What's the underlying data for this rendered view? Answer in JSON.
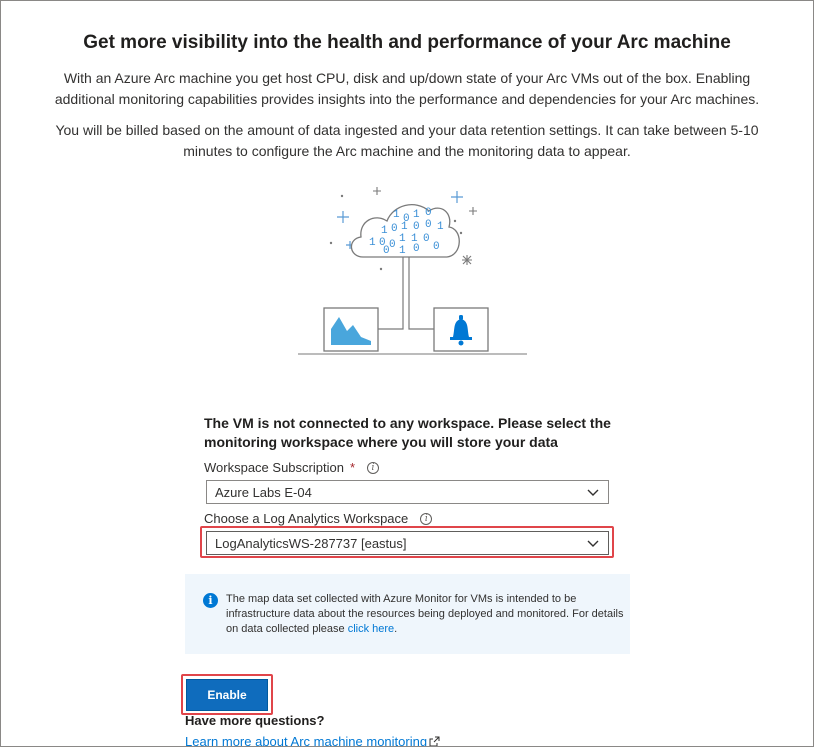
{
  "header": {
    "title": "Get more visibility into the health and performance of your Arc machine"
  },
  "intro": {
    "paragraph1": "With an Azure Arc machine you get host CPU, disk and up/down state of your Arc VMs out of the box.  Enabling additional monitoring capabilities provides insights into the performance and dependencies for your Arc machines.",
    "paragraph2": "You will be billed based on the amount of data ingested and your data retention settings. It can take between 5-10 minutes to configure the Arc machine and the monitoring data to appear."
  },
  "illustration": {
    "cloud_digits": [
      "1",
      "0",
      "1",
      "0",
      "0",
      "1",
      "1",
      "0",
      "1",
      "0",
      "0",
      "1",
      "1",
      "0",
      "0",
      "1",
      "0",
      "0",
      "1",
      "0"
    ],
    "icons": [
      "cloud-icon",
      "chart-icon",
      "bell-icon"
    ]
  },
  "form": {
    "title": "The VM is not connected to any workspace. Please select the monitoring workspace where you will store your data",
    "subscription": {
      "label": "Workspace Subscription",
      "required_mark": "*",
      "value": "Azure Labs E-04"
    },
    "workspace": {
      "label": "Choose a Log Analytics Workspace",
      "value": "LogAnalyticsWS-287737 [eastus]"
    }
  },
  "info_box": {
    "text": "The map data set collected with Azure Monitor for VMs is intended to be infrastructure data about the resources being deployed and monitored. For details on data collected please ",
    "link_text": "click here",
    "suffix": "."
  },
  "actions": {
    "enable_label": "Enable"
  },
  "footer": {
    "questions": "Have more questions?",
    "learn_more": "Learn more about Arc machine monitoring"
  },
  "colors": {
    "accent": "#0078d4",
    "button": "#0f6cbd",
    "highlight": "#e0454a",
    "info_bg": "#eff6fc"
  }
}
